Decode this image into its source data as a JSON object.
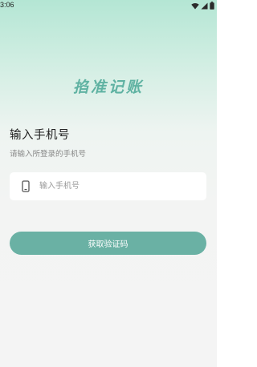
{
  "status_bar": {
    "time": "3:06",
    "icons": [
      "wifi-icon",
      "cellular-signal-icon",
      "battery-icon"
    ]
  },
  "app": {
    "logo_text": "掐准记账",
    "accent_color": "#6ab1a4",
    "logo_color": "#5fb2a2"
  },
  "login": {
    "title": "输入手机号",
    "subtitle": "请输入所登录的手机号",
    "phone_placeholder": "输入手机号",
    "phone_value": "",
    "phone_icon": "mobile-phone-icon",
    "submit_label": "获取验证码"
  }
}
